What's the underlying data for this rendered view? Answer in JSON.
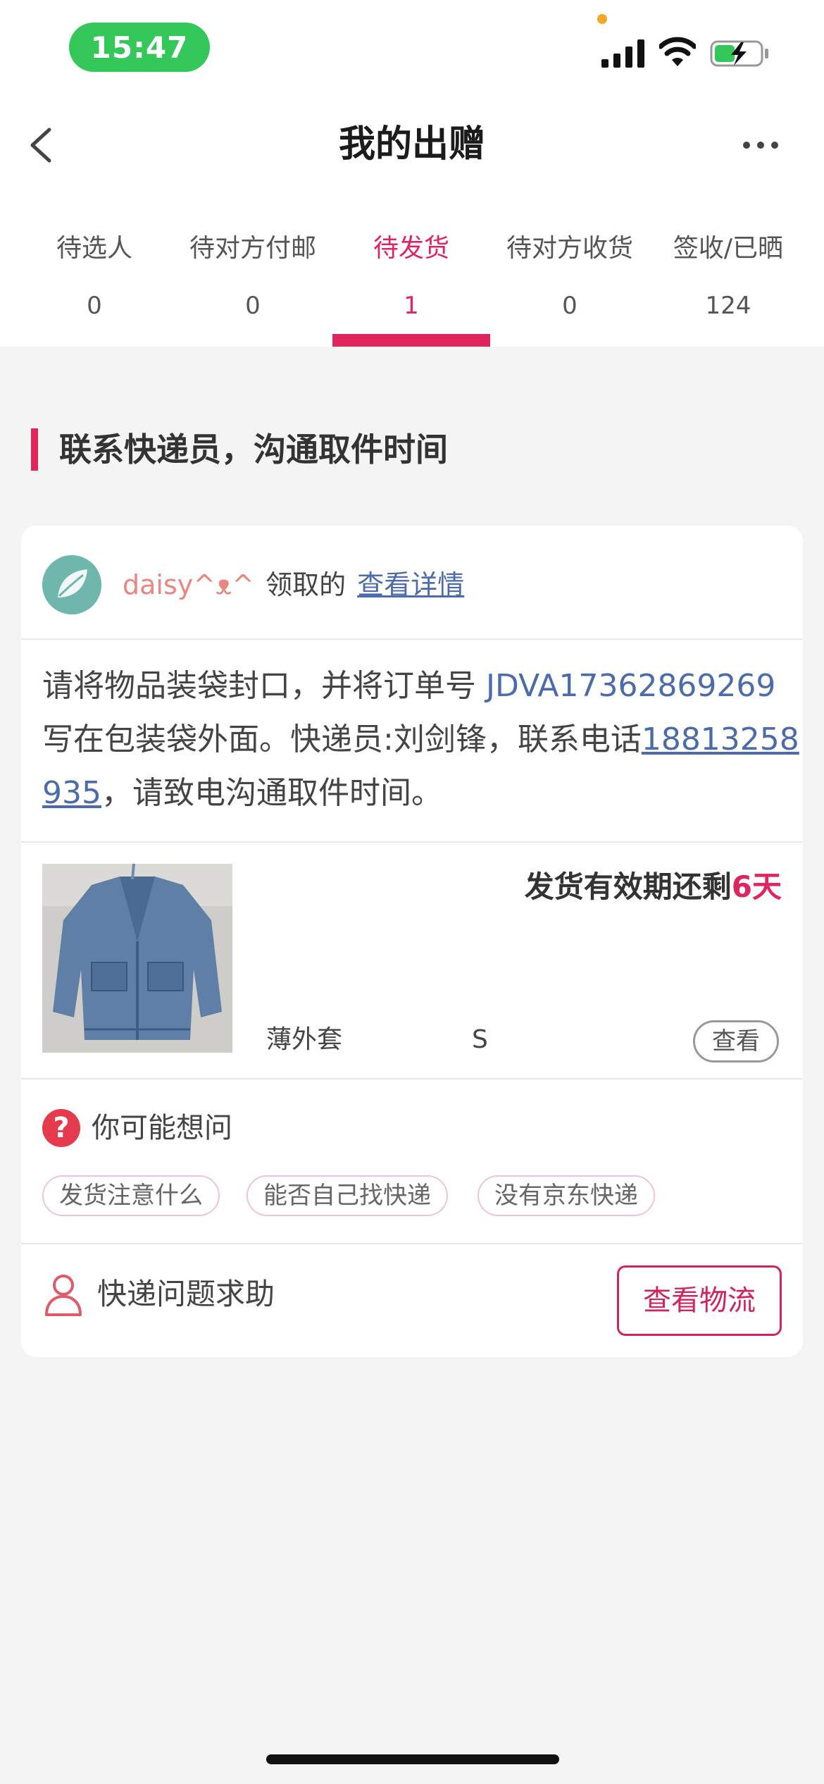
{
  "status_bar": {
    "time": "15:47",
    "icons": [
      "signal-icon",
      "wifi-icon",
      "battery-charging-icon"
    ],
    "colors": {
      "time_pill": "#34c759",
      "dot": "#f5a623"
    }
  },
  "nav": {
    "title": "我的出赠",
    "back_icon": "chevron-left-icon",
    "more_icon": "more-dots-icon"
  },
  "tabs": [
    {
      "label": "待选人",
      "count": "0"
    },
    {
      "label": "待对方付邮",
      "count": "0"
    },
    {
      "label": "待发货",
      "count": "1",
      "active": true
    },
    {
      "label": "待对方收货",
      "count": "0"
    },
    {
      "label": "签收/已晒",
      "count": "124"
    }
  ],
  "section": {
    "title": "联系快递员，沟通取件时间"
  },
  "card": {
    "claimer": {
      "name": "daisy^ᴥ^",
      "suffix": "领取的",
      "detail_link": "查看详情"
    },
    "instruction": {
      "part1": "请将物品装袋封口，并将订单号 ",
      "order_no": "JDVA17362869269",
      "part2": " 写在包装袋外面。快递员:刘剑锋，联系电话",
      "phone": "18813258935",
      "part3": "，请致电沟通取件时间。"
    },
    "product": {
      "deadline_prefix": "发货有效期还剩",
      "deadline_days": "6天",
      "type": "薄外套",
      "size": "S",
      "view_label": "查看",
      "image_desc": "denim-jacket-image"
    },
    "faq": {
      "title": "你可能想问",
      "icon": "question-icon",
      "chips": [
        "发货注意什么",
        "能否自己找快递",
        "没有京东快递"
      ]
    },
    "help": {
      "label": "快递问题求助",
      "icon": "person-icon",
      "logistics_button": "查看物流"
    }
  },
  "colors": {
    "accent": "#e0245e",
    "link": "#4b6bab",
    "background": "#f4f4f4"
  }
}
